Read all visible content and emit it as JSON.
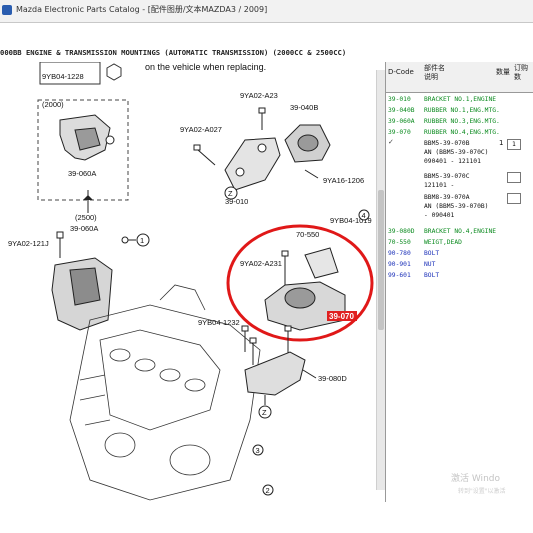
{
  "window": {
    "title": "Mazda Electronic Parts Catalog - [配件图册/文本MAZDA3 / 2009]"
  },
  "page_title": "000BB  ENGINE & TRANSMISSION MOUNTINGS (AUTOMATIC TRANSMISSION) (2000CC & 2500CC)",
  "diagram": {
    "note": "on the vehicle when replacing.",
    "labels": {
      "top_left_code": "9YB04-1228",
      "c2000": "(2000)",
      "c39_060A_top": "39-060A",
      "c2500": "(2500)",
      "c39_060A_bottom": "39-060A",
      "c9YA02_121J": "9YA02-121J",
      "c9YA02_A23": "9YA02-A23",
      "c39_040B": "39-040B",
      "c9YA02_A027": "9YA02-A027",
      "c9YA16_1206": "9YA16-1206",
      "c39_010": "39-010",
      "c9YB04_1019": "9YB04-1019",
      "c70_550": "70-550",
      "c9YA02_A231": "9YA02-A231",
      "c39_070": "39-070",
      "c9YB04_1232": "9YB04-1232",
      "c39_080D": "39-080D"
    },
    "circles": {
      "c1": "1",
      "c2": "2",
      "c3": "3",
      "c4": "4",
      "z1": "Z",
      "z2": "Z"
    }
  },
  "table": {
    "headers": {
      "code": "D-Code",
      "name_l1": "部件名",
      "name_l2": "说明",
      "col3": "数量",
      "col4_l1": "订购",
      "col4_l2": "数"
    },
    "rows": [
      {
        "code": "39-010",
        "name": "BRACKET NO.1,ENGINE",
        "color": "green"
      },
      {
        "code": "39-040B",
        "name": "RUBBER NO.1,ENG.MTG.",
        "color": "green"
      },
      {
        "code": "39-060A",
        "name": "RUBBER NO.3,ENG.MTG.",
        "color": "green"
      },
      {
        "code": "39-070",
        "name": "RUBBER NO.4,ENG.MTG.",
        "color": "green"
      }
    ],
    "subs": [
      {
        "l1": "BBM5-39-070B",
        "l2": "AN (BBM5-39-070C)",
        "l3": "090401  - 121101",
        "qty": "1",
        "box": "1"
      },
      {
        "l1": "BBM5-39-070C",
        "l2": "121101  -",
        "box": ""
      },
      {
        "l1": "BBM8-39-070A",
        "l2": "AN (BBM5-39-070B)",
        "l3": "- 090401",
        "box": ""
      }
    ],
    "rows2": [
      {
        "code": "39-080D",
        "name": "BRACKET NO.4,ENGINE",
        "color": "green"
      },
      {
        "code": "70-550",
        "name": "WEIGT,DEAD",
        "color": "green"
      },
      {
        "code": "90-780",
        "name": "BOLT",
        "color": "blue"
      },
      {
        "code": "90-901",
        "name": "NUT",
        "color": "blue"
      },
      {
        "code": "99-601",
        "name": "BOLT",
        "color": "blue"
      }
    ]
  },
  "watermark": {
    "line1": "激活 Windo",
    "line2": "转到\"设置\"以激活"
  }
}
